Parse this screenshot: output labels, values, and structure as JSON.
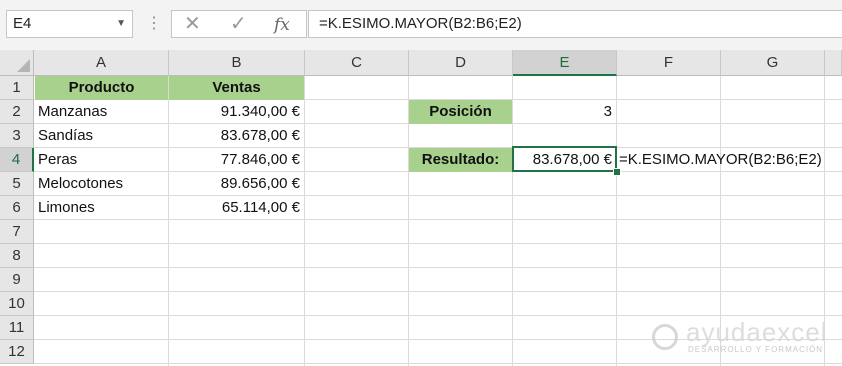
{
  "formula_bar": {
    "name_box": "E4",
    "cancel_icon": "✕",
    "enter_icon": "✓",
    "fx_label": "fx",
    "formula": "=K.ESIMO.MAYOR(B2:B6;E2)"
  },
  "columns": [
    "A",
    "B",
    "C",
    "D",
    "E",
    "F",
    "G"
  ],
  "rows": [
    "1",
    "2",
    "3",
    "4",
    "5",
    "6",
    "7",
    "8",
    "9",
    "10",
    "11",
    "12"
  ],
  "selected_cell": {
    "column": "E",
    "row": "4"
  },
  "table": {
    "header_producto": "Producto",
    "header_ventas": "Ventas",
    "items": [
      {
        "producto": "Manzanas",
        "ventas": "91.340,00 €"
      },
      {
        "producto": "Sandías",
        "ventas": "83.678,00 €"
      },
      {
        "producto": "Peras",
        "ventas": "77.846,00 €"
      },
      {
        "producto": "Melocotones",
        "ventas": "89.656,00 €"
      },
      {
        "producto": "Limones",
        "ventas": "65.114,00 €"
      }
    ]
  },
  "lookup": {
    "posicion_label": "Posición",
    "posicion_value": "3",
    "resultado_label": "Resultado:",
    "resultado_value": "83.678,00 €",
    "formula_text": "=K.ESIMO.MAYOR(B2:B6;E2)"
  },
  "colors": {
    "header_fill": "#a9d18e",
    "selection_green": "#217346"
  },
  "watermark": {
    "brand": "ayudaexcel",
    "tagline": "DESARROLLO Y FORMACIÓN"
  }
}
